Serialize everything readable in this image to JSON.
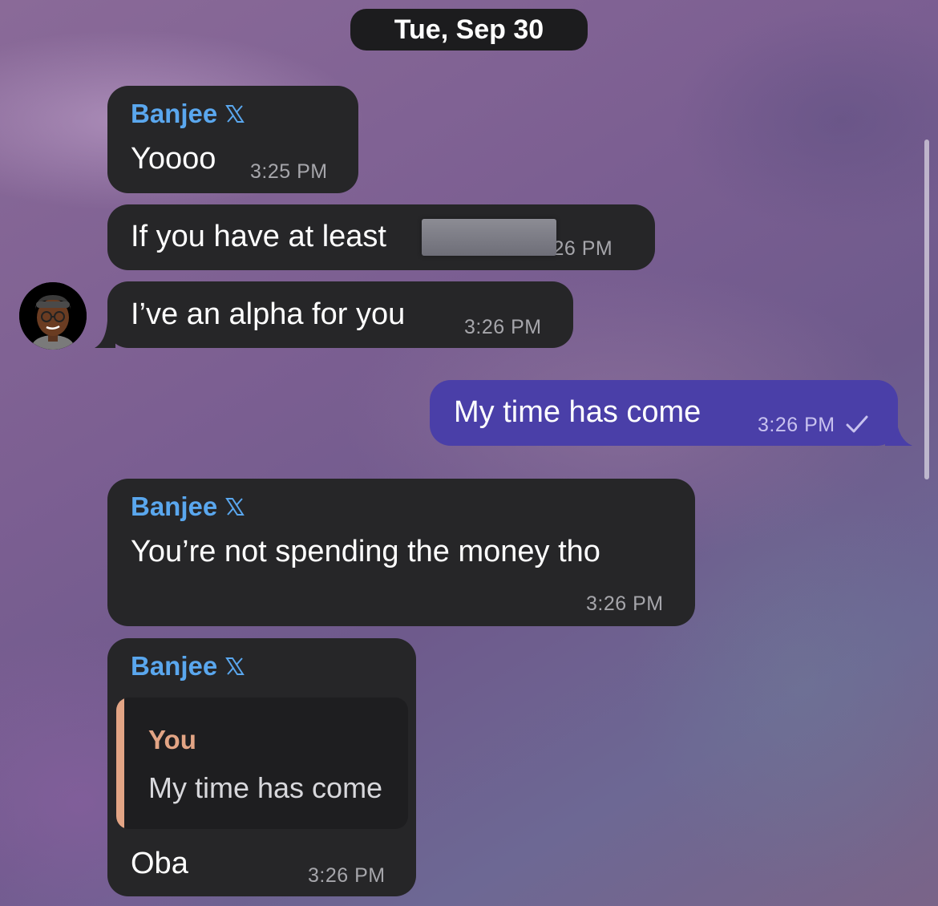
{
  "date_header": "Tue, Sep 30",
  "messages": [
    {
      "sender": "Banjee",
      "sender_badge": "x-logo-icon",
      "text": "Yoooo",
      "time": "3:25 PM"
    },
    {
      "text": "If you have at least",
      "time_visible": ":26 PM",
      "redacted": true
    },
    {
      "text": "I’ve an alpha for you",
      "time": "3:26 PM"
    },
    {
      "text": "My time has come",
      "time": "3:26 PM",
      "status": "check-icon",
      "outgoing": true
    },
    {
      "sender": "Banjee",
      "sender_badge": "x-logo-icon",
      "text": "You’re not spending the money tho",
      "time": "3:26 PM"
    },
    {
      "sender": "Banjee",
      "sender_badge": "x-logo-icon",
      "reply_to": {
        "author": "You",
        "text": "My time has come"
      },
      "text": "Oba",
      "time": "3:26 PM"
    }
  ],
  "colors": {
    "incoming_bubble": "#262628",
    "outgoing_bubble": "#4a3fa8",
    "sender_name": "#5aa7ee",
    "quote_accent": "#e3a585"
  }
}
